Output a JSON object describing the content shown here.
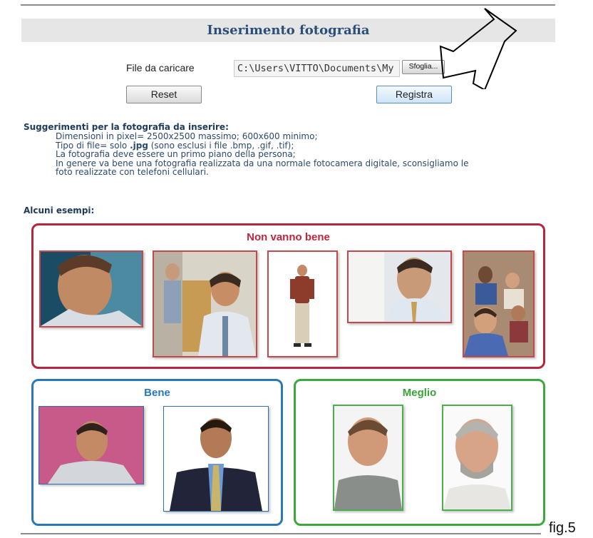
{
  "header": {
    "title": "Inserimento fotografia"
  },
  "form": {
    "file_label": "File da caricare",
    "file_value": "C:\\Users\\VITTO\\Documents\\My",
    "browse_label": "Sfoglia...",
    "reset_label": "Reset",
    "save_label": "Registra"
  },
  "hints": {
    "title": "Suggerimenti per la fotografia da inserire:",
    "line1": "Dimensioni in pixel= 2500x2500 massimo; 600x600 minimo;",
    "line2_prefix": "Tipo di file= solo ",
    "line2_bold": ".jpg",
    "line2_suffix": " (sono esclusi i file .bmp, .gif, .tif);",
    "line3": "La fotografia deve essere un primo piano della persona;",
    "line4": "In genere va bene una fotografia realizzata da una normale fotocamera digitale, sconsigliamo le",
    "line5": "foto realizzate con telefoni cellulari."
  },
  "examples": {
    "title": "Alcuni esempi:",
    "bad": {
      "title": "Non vanno bene",
      "color": "#c0263b"
    },
    "good": {
      "title": "Bene",
      "color": "#2b78b8"
    },
    "better": {
      "title": "Meglio",
      "color": "#3aa43a"
    }
  },
  "caption": "fig.5"
}
